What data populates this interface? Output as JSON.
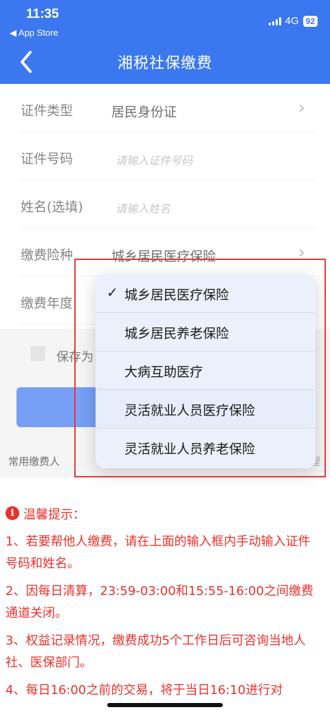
{
  "status_bar": {
    "time": "11:35",
    "back_app": "◀ App Store",
    "network": "4G",
    "battery": "92"
  },
  "nav": {
    "title": "湘税社保缴费",
    "back_glyph": "<"
  },
  "form": {
    "id_type": {
      "label": "证件类型",
      "value": "居民身份证"
    },
    "id_number": {
      "label": "证件号码",
      "placeholder": "请输入证件号码"
    },
    "name": {
      "label": "姓名(选填)",
      "placeholder": "请输入姓名"
    },
    "insurance_type": {
      "label": "缴费险种",
      "value": "城乡居民医疗保险"
    },
    "year": {
      "label": "缴费年度"
    },
    "save_label": "保存为",
    "common_payer": "常用缴费人",
    "common_right": "理"
  },
  "dropdown": {
    "selected_index": 0,
    "check_glyph": "✓",
    "options": [
      "城乡居民医疗保险",
      "城乡居民养老保险",
      "大病互助医疗",
      "灵活就业人员医疗保险",
      "灵活就业人员养老保险"
    ]
  },
  "tips": {
    "title": "温馨提示：",
    "items": [
      "1、若要帮他人缴费，请在上面的输入框内手动输入证件号码和姓名。",
      "2、因每日清算，23:59-03:00和15:55-16:00之间缴费通道关闭。",
      "3、权益记录情况，缴费成功5个工作日后可咨询当地人社、医保部门。",
      "4、每日16:00之前的交易，将于当日16:10进行对"
    ]
  },
  "colors": {
    "brand_blue": "#3b78f0",
    "tip_red": "#e8322c",
    "highlight_red": "#e53935"
  }
}
